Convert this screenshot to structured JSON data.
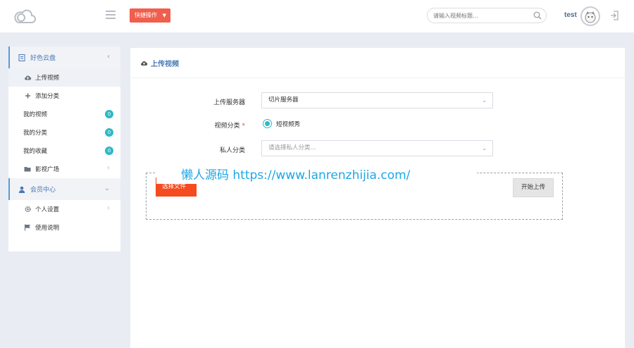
{
  "header": {
    "quick_action_label": "快捷操作",
    "search_placeholder": "请输入视频标题...",
    "username": "test"
  },
  "sidebar": {
    "groups": [
      {
        "label": "好色云盘",
        "items": [
          {
            "label": "上传视频",
            "active": true
          },
          {
            "label": "添加分类"
          },
          {
            "label": "我的视频",
            "badge": "0"
          },
          {
            "label": "我的分类",
            "badge": "0"
          },
          {
            "label": "我的收藏",
            "badge": "0"
          },
          {
            "label": "影视广场"
          }
        ]
      },
      {
        "label": "会员中心",
        "items": [
          {
            "label": "个人设置"
          },
          {
            "label": "使用说明"
          }
        ]
      }
    ]
  },
  "main": {
    "title": "上传视频",
    "form": {
      "server_label": "上传服务器",
      "server_value": "切片服务器",
      "category_label": "视频分类",
      "category_option": "短视频秀",
      "private_label": "私人分类",
      "private_placeholder": "请选择私人分类..."
    },
    "upload": {
      "choose_label": "选择文件",
      "start_label": "开始上传"
    }
  },
  "watermark": "懒人源码 https://www.lanrenzhijia.com/",
  "colors": {
    "accent_blue": "#4a79b4",
    "quick_red": "#f05f4d",
    "choose_orange": "#f54b1f",
    "badge_teal": "#2fb8c6",
    "watermark_blue": "#1ea7e6"
  }
}
